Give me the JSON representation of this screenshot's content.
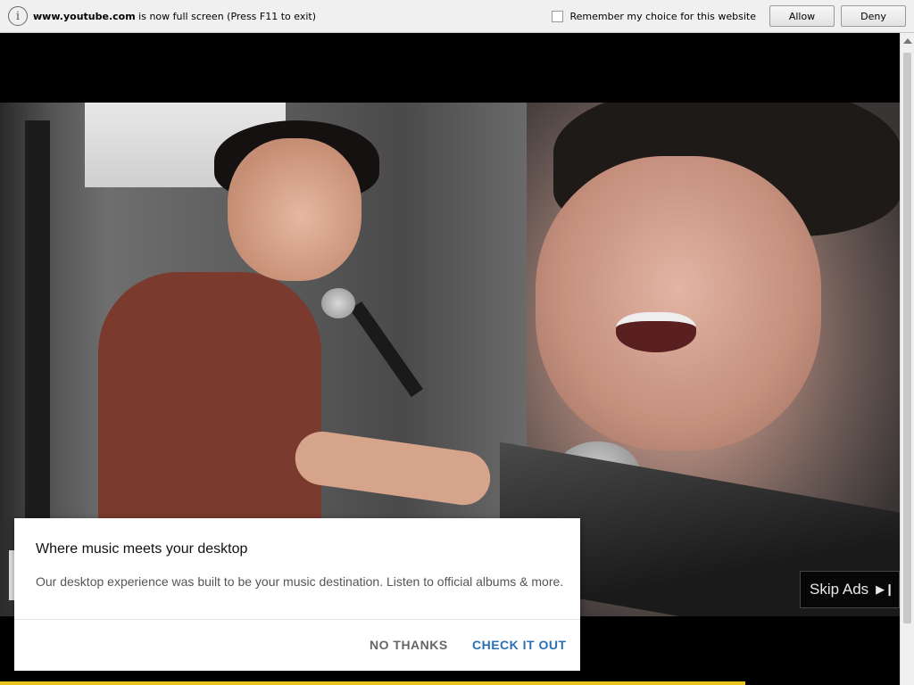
{
  "notification": {
    "domain": "www.youtube.com",
    "message": "is now full screen (Press F11 to exit)",
    "remember_label": "Remember my choice for this website",
    "allow_label": "Allow",
    "deny_label": "Deny"
  },
  "player": {
    "skip_ads_label": "Skip Ads"
  },
  "dialog": {
    "title": "Where music meets your desktop",
    "body": "Our desktop experience was built to be your music destination. Listen to official albums & more.",
    "no_thanks_label": "NO THANKS",
    "check_it_out_label": "CHECK IT OUT"
  },
  "colors": {
    "link_blue": "#2a6fb5",
    "progress_yellow": "#e9c21e"
  }
}
